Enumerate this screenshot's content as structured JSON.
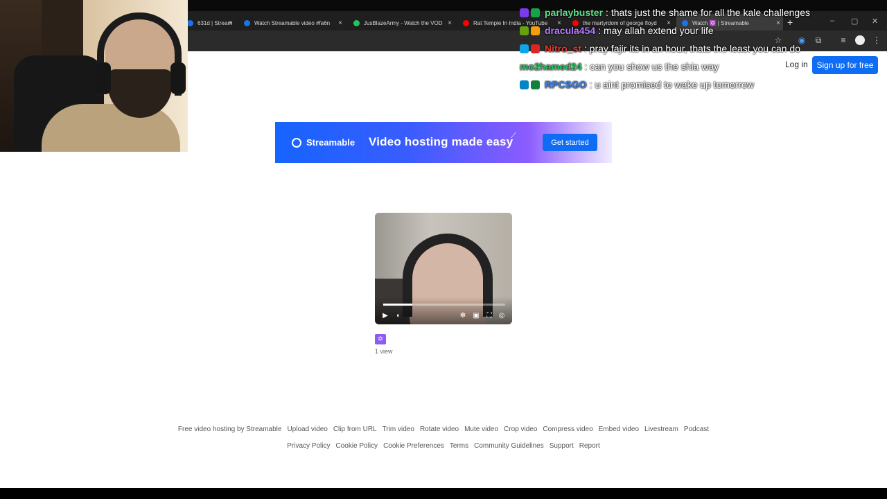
{
  "browser": {
    "tabs": [
      {
        "label": "631d | Stream",
        "favicon_color": "#1a73e8"
      },
      {
        "label": "Watch Streamable video #fa6n",
        "favicon_color": "#1a73e8"
      },
      {
        "label": "JusBlazeArmy - Watch the VOD",
        "favicon_color": "#22c55e"
      },
      {
        "label": "Rat Temple In India - YouTube",
        "favicon_color": "#ff0000"
      },
      {
        "label": "the martyrdom of george floyd",
        "favicon_color": "#ff0000"
      },
      {
        "label": "Watch ✡️ | Streamable",
        "favicon_color": "#1a73e8"
      }
    ],
    "new_tab": "+",
    "close_glyph": "×"
  },
  "chat": [
    {
      "user": "parlaybuster",
      "user_color": "#5fe08a",
      "message": ": thats just the shame for all the kale challenges",
      "badges": [
        "#7c3aed",
        "#16a34a"
      ]
    },
    {
      "user": "dracula454",
      "user_color": "#b57cff",
      "message": ": may allah extend your life",
      "badges": [
        "#65a30d",
        "#f59e0b"
      ]
    },
    {
      "user": "Nitro_st",
      "user_color": "#e53935",
      "message": ": pray fajir its in an hour, thats the least you can do",
      "badges": [
        "#0ea5e9",
        "#dc2626"
      ]
    },
    {
      "user": "mo2hamed24",
      "user_color": "#22c55e",
      "message": ": can you show us the shia way",
      "badges": []
    },
    {
      "user": "RPCSGO",
      "user_color": "#3b82f6",
      "message": ": u aint promised to wake up tomorrow",
      "badges": [
        "#0284c7",
        "#15803d"
      ]
    }
  ],
  "header": {
    "login": "Log in",
    "signup": "Sign up for free"
  },
  "banner": {
    "brand": "Streamable",
    "tagline": "Video hosting made easy",
    "cta": "Get started"
  },
  "video": {
    "progress": 0.24,
    "views": "1 view",
    "uploader_glyph": "✡"
  },
  "footer": {
    "row1": [
      "Free video hosting by Streamable",
      "Upload video",
      "Clip from URL",
      "Trim video",
      "Rotate video",
      "Mute video",
      "Crop video",
      "Compress video",
      "Embed video",
      "Livestream",
      "Podcast"
    ],
    "row2": [
      "Privacy Policy",
      "Cookie Policy",
      "Cookie Preferences",
      "Terms",
      "Community Guidelines",
      "Support",
      "Report"
    ]
  }
}
